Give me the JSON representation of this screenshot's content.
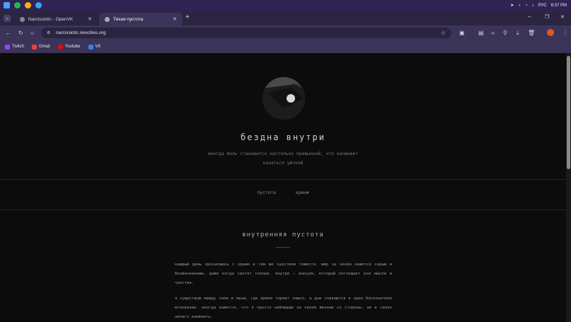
{
  "taskbar": {
    "lang": "РУС",
    "time": "8:37 PM"
  },
  "tabs": [
    {
      "title": "Narcissistic - OpenVK",
      "active": false
    },
    {
      "title": "Тихая пустота",
      "active": true
    }
  ],
  "toolbar": {
    "url": "narcissictic.neocities.org"
  },
  "bookmarks": [
    {
      "label": "Twitch",
      "color": "#9146ff"
    },
    {
      "label": "Gmail",
      "color": "#ea4335"
    },
    {
      "label": "Youtube",
      "color": "#ff0000"
    },
    {
      "label": "VK",
      "color": "#2787f5"
    }
  ],
  "site": {
    "title": "бездна внутри",
    "subtitle": "иногда боль становится настолько привычной, что начинает казаться уютной",
    "menu": [
      "пустота",
      "кринж"
    ],
    "section_title": "внутренняя пустота",
    "paragraphs": [
      "каждый день просыпаюсь с одним и тем же чувством тяжести. мир за окном кажется серым и безжизненным, даже когда светит солнце. внутри — вакуум, который поглощает все мысли и чувства.",
      "я существую между сном и явью, где время теряет смысл, а дни сливаются в одно бесконечное мгновение. иногда кажется, что я просто наблюдаю за своей жизнью со стороны, не в силах ничего изменить."
    ]
  }
}
